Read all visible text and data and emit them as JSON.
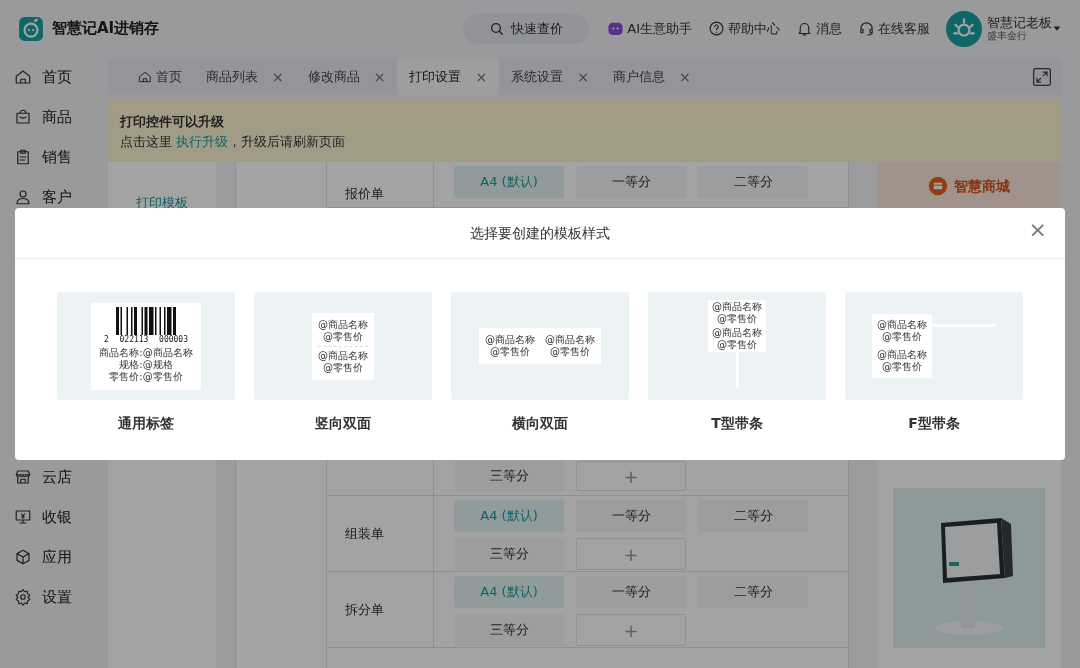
{
  "header": {
    "app_name": "智慧记AI进销存",
    "search_label": "快速查价",
    "links": [
      {
        "kind": "ai",
        "label": "AI生意助手"
      },
      {
        "kind": "help",
        "label": "帮助中心"
      },
      {
        "kind": "bell",
        "label": "消息"
      },
      {
        "kind": "service",
        "label": "在线客服"
      }
    ],
    "user": {
      "name": "智慧记老板",
      "shop": "盛丰金行"
    }
  },
  "sidebar": {
    "items": [
      {
        "kind": "home",
        "label": "首页"
      },
      {
        "kind": "goods",
        "label": "商品"
      },
      {
        "kind": "sales",
        "label": "销售"
      },
      {
        "kind": "customer",
        "label": "客户"
      },
      {
        "kind": "store",
        "label": "云店"
      },
      {
        "kind": "cashier",
        "label": "收银"
      },
      {
        "kind": "apps",
        "label": "应用"
      },
      {
        "kind": "settings",
        "label": "设置"
      }
    ]
  },
  "tabs": [
    {
      "label": "首页",
      "kind": "home",
      "selected": false
    },
    {
      "label": "商品列表",
      "close": "×",
      "selected": false
    },
    {
      "label": "修改商品",
      "close": "×",
      "selected": false
    },
    {
      "label": "打印设置",
      "close": "×",
      "selected": true
    },
    {
      "label": "系统设置",
      "close": "×",
      "selected": false
    },
    {
      "label": "商户信息",
      "close": "×",
      "selected": false
    }
  ],
  "notice": {
    "title": "打印控件可以升级",
    "text_before": "点击这里",
    "link": "执行升级",
    "text_after": "，升级后请刷新页面"
  },
  "print_settings": {
    "left_menu": [
      {
        "label": "打印模板",
        "selected": true
      }
    ],
    "rows": [
      {
        "kind": "top_cut",
        "name": "报价单",
        "options": [
          {
            "kind": "option",
            "label": "A4 (默认)",
            "selected": true
          },
          {
            "kind": "option",
            "label": "一等分",
            "selected": false
          },
          {
            "kind": "option",
            "label": "二等分",
            "selected": false
          }
        ]
      },
      {
        "kind": "tail",
        "options": [
          {
            "kind": "option",
            "label": "三等分",
            "selected": false
          },
          {
            "kind": "add",
            "label": "+",
            "selected": false
          }
        ]
      },
      {
        "kind": "full",
        "name": "组装单",
        "options": [
          {
            "kind": "option",
            "label": "A4 (默认)",
            "selected": true
          },
          {
            "kind": "option",
            "label": "一等分",
            "selected": false
          },
          {
            "kind": "option",
            "label": "二等分",
            "selected": false
          },
          {
            "kind": "option",
            "label": "三等分",
            "selected": false
          },
          {
            "kind": "add",
            "label": "+",
            "selected": false
          }
        ]
      },
      {
        "kind": "full",
        "name": "拆分单",
        "options": [
          {
            "kind": "option",
            "label": "A4 (默认)",
            "selected": true
          },
          {
            "kind": "option",
            "label": "一等分",
            "selected": false
          },
          {
            "kind": "option",
            "label": "二等分",
            "selected": false
          },
          {
            "kind": "option",
            "label": "三等分",
            "selected": false
          },
          {
            "kind": "add",
            "label": "+",
            "selected": false
          }
        ]
      }
    ]
  },
  "right_panel": {
    "mall_label": "智慧商城"
  },
  "dialog": {
    "title": "选择要创建的模板样式",
    "close": "×",
    "templates": [
      {
        "kind": "general",
        "label": "通用标签",
        "barcode_digits": [
          "2",
          "022113",
          "000003"
        ],
        "blocks": [
          [
            "商品名称:@商品名称",
            "规格:@规格",
            "零售价:@零售价"
          ]
        ]
      },
      {
        "kind": "vertical",
        "label": "竖向双面",
        "blocks": [
          [
            "@商品名称",
            "@零售价"
          ],
          [
            "@商品名称",
            "@零售价"
          ]
        ]
      },
      {
        "kind": "horizontal",
        "label": "横向双面",
        "blocks": [
          [
            "@商品名称",
            "@零售价"
          ],
          [
            "@商品名称",
            "@零售价"
          ]
        ]
      },
      {
        "kind": "t_strip",
        "label": "T型带条",
        "blocks": [
          [
            "@商品名称",
            "@零售价"
          ],
          [
            "@商品名称",
            "@零售价"
          ]
        ]
      },
      {
        "kind": "f_strip",
        "label": "F型带条",
        "blocks": [
          [
            "@商品名称",
            "@零售价"
          ],
          [
            "@商品名称",
            "@零售价"
          ]
        ]
      }
    ]
  }
}
